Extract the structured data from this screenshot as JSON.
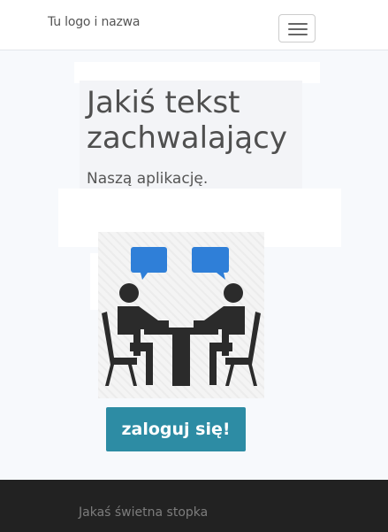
{
  "navbar": {
    "brand": "Tu logo i nazwa",
    "toggler_icon": "hamburger-menu-icon"
  },
  "hero": {
    "headline": "Jakiś tekst zachwalający",
    "subtext": "Naszą aplikację."
  },
  "illustration": {
    "icon": "people-at-table-chatting-icon",
    "bubble_color": "#2f7fd8",
    "figure_color": "#2b2b2b"
  },
  "login_button": {
    "label": "zaloguj się!",
    "color": "#2d8ca4"
  },
  "footer": {
    "text": "Jakaś świetna stopka",
    "background": "#222222"
  }
}
